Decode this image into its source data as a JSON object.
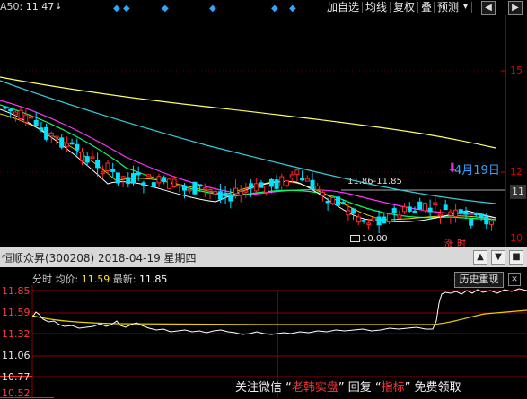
{
  "toolbar": {
    "ma_label": "A50:",
    "ma_value": "11.47",
    "ma_arrow": "↓",
    "buttons": [
      "加自选",
      "均线",
      "复权",
      "叠",
      "预测"
    ],
    "dropdown_glyph": "▾",
    "left_arrow": "◀",
    "right_arrow": "▶"
  },
  "price_axis": {
    "labels": [
      "15",
      "12",
      "11",
      "10"
    ]
  },
  "annotations": {
    "date_label": "4月19日",
    "range_label": "11.86-11.85",
    "low_label": "10.00",
    "tags": [
      "涨",
      "时"
    ]
  },
  "info_bar": {
    "text": "恒顺众昇(300208) 2018-04-19 星期四",
    "controls": [
      "▲",
      "▼",
      "■"
    ]
  },
  "timeshare": {
    "mode": "分时",
    "avg_label": "均价:",
    "avg_value": "11.59",
    "latest_label": "最新:",
    "latest_value": "11.85",
    "history_button": "历史重现",
    "close_glyph": "✕",
    "levels": [
      "11.85",
      "11.59",
      "11.32",
      "11.06",
      "10.77",
      "10.52"
    ]
  },
  "footer": {
    "text_before": "关注微信 “",
    "highlight1": "老韩实盘",
    "text_mid": "” 回复 “",
    "highlight2": "指标",
    "text_after": "” 免费领取"
  },
  "colors": {
    "background": "#000000",
    "up": "#ff2a2a",
    "down": "#00e0ff",
    "ma5": "#ffffff",
    "ma10": "#e6d000",
    "ma20": "#ff33ff",
    "ma30": "#00ff66",
    "ma60": "#33ccdd",
    "ma120": "#ffff66"
  }
}
